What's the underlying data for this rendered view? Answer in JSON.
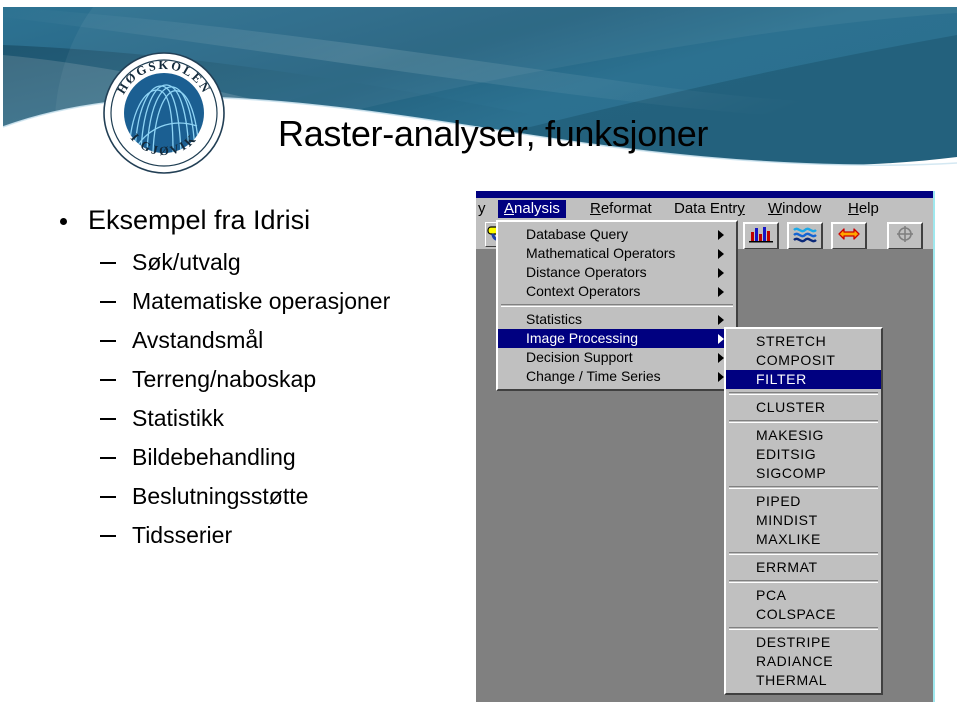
{
  "slide": {
    "title": "Raster-analyser, funksjoner",
    "banner_color": "#2e7architect",
    "logo": {
      "top_arc_text": "HØGSKOLEN",
      "bottom_arc_text": "I GJØVIK"
    },
    "bullets": {
      "level1": "Eksempel fra Idrisi",
      "level2": [
        "Søk/utvalg",
        "Matematiske operasjoner",
        "Avstandsmål",
        "Terreng/naboskap",
        "Statistikk",
        "Bildebehandling",
        "Beslutningsstøtte",
        "Tidsserier"
      ]
    }
  },
  "idrisi": {
    "menubar": {
      "clipped_item": "y",
      "items": [
        {
          "accel": "A",
          "rest": "nalysis",
          "selected": true
        },
        {
          "accel": "R",
          "rest": "eformat",
          "selected": false
        },
        {
          "accel": "",
          "rest": "Data Entry",
          "selected": false
        },
        {
          "accel": "W",
          "rest": "indow",
          "selected": false
        },
        {
          "accel": "H",
          "rest": "elp",
          "selected": false
        }
      ],
      "labels": {
        "analysis": "Analysis",
        "reformat": "Reformat",
        "data_entry": "Data Entry",
        "window": "Window",
        "help": "Help"
      }
    },
    "toolbar": {
      "buttons": [
        {
          "icon": "bar-chart-icon",
          "enabled": true
        },
        {
          "icon": "waves-icon",
          "enabled": true
        },
        {
          "icon": "double-arrow-icon",
          "enabled": true
        },
        {
          "icon": "crosshair-circle-icon",
          "enabled": false
        }
      ]
    },
    "analysis_menu": {
      "groups": [
        [
          {
            "label": "Database Query",
            "submenu": true,
            "highlighted": false
          },
          {
            "label": "Mathematical Operators",
            "submenu": true,
            "highlighted": false
          },
          {
            "label": "Distance Operators",
            "submenu": true,
            "highlighted": false
          },
          {
            "label": "Context Operators",
            "submenu": true,
            "highlighted": false
          }
        ],
        [
          {
            "label": "Statistics",
            "submenu": true,
            "highlighted": false
          },
          {
            "label": "Image Processing",
            "submenu": true,
            "highlighted": true
          },
          {
            "label": "Decision Support",
            "submenu": true,
            "highlighted": false
          },
          {
            "label": "Change / Time Series",
            "submenu": true,
            "highlighted": false
          }
        ]
      ]
    },
    "image_processing_submenu": {
      "groups": [
        [
          {
            "label": "STRETCH",
            "highlighted": false
          },
          {
            "label": "COMPOSIT",
            "highlighted": false
          },
          {
            "label": "FILTER",
            "highlighted": true
          }
        ],
        [
          {
            "label": "CLUSTER",
            "highlighted": false
          }
        ],
        [
          {
            "label": "MAKESIG",
            "highlighted": false
          },
          {
            "label": "EDITSIG",
            "highlighted": false
          },
          {
            "label": "SIGCOMP",
            "highlighted": false
          }
        ],
        [
          {
            "label": "PIPED",
            "highlighted": false
          },
          {
            "label": "MINDIST",
            "highlighted": false
          },
          {
            "label": "MAXLIKE",
            "highlighted": false
          }
        ],
        [
          {
            "label": "ERRMAT",
            "highlighted": false
          }
        ],
        [
          {
            "label": "PCA",
            "highlighted": false
          },
          {
            "label": "COLSPACE",
            "highlighted": false
          }
        ],
        [
          {
            "label": "DESTRIPE",
            "highlighted": false
          },
          {
            "label": "RADIANCE",
            "highlighted": false
          },
          {
            "label": "THERMAL",
            "highlighted": false
          }
        ]
      ]
    }
  },
  "colors": {
    "banner_teal": "#2b6e8f",
    "banner_dark": "#1b4f68",
    "menu_highlight": "#000080",
    "menu_face": "#c0c0c0",
    "client_gray": "#808080",
    "accent_cyan": "#9fe8ee"
  }
}
